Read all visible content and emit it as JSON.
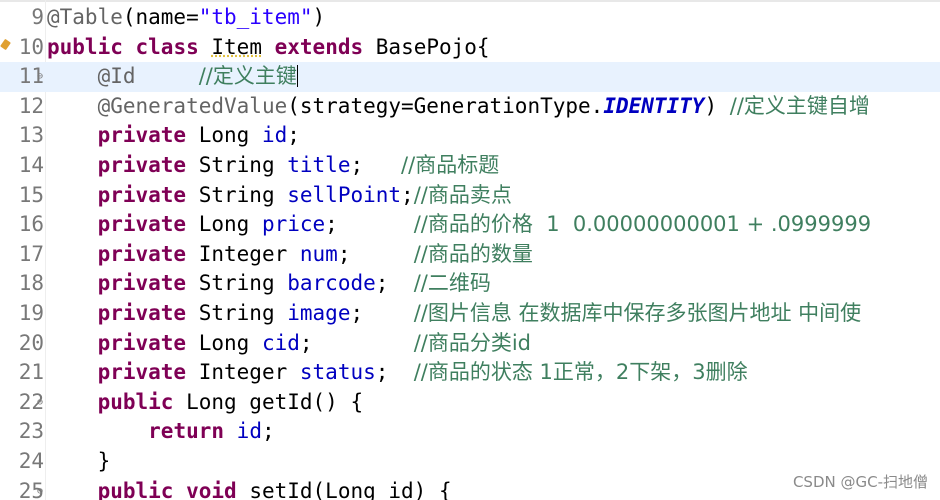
{
  "editor": {
    "lines": [
      {
        "num": "9",
        "tokens": [
          {
            "t": "ann",
            "v": "@Table"
          },
          {
            "t": "plain",
            "v": "(name="
          },
          {
            "t": "str",
            "v": "\"tb_item\""
          },
          {
            "t": "plain",
            "v": ")"
          }
        ]
      },
      {
        "num": "10",
        "marker": true,
        "tokens": [
          {
            "t": "kw",
            "v": "public"
          },
          {
            "t": "plain",
            "v": " "
          },
          {
            "t": "kw",
            "v": "class"
          },
          {
            "t": "plain",
            "v": " "
          },
          {
            "t": "plain",
            "v": "Item",
            "ul": true
          },
          {
            "t": "plain",
            "v": " "
          },
          {
            "t": "kw",
            "v": "extends"
          },
          {
            "t": "plain",
            "v": " BasePojo{"
          }
        ]
      },
      {
        "num": "11",
        "fold": true,
        "current": true,
        "cursor": true,
        "tokens": [
          {
            "t": "plain",
            "v": "    "
          },
          {
            "t": "ann",
            "v": "@Id"
          },
          {
            "t": "plain",
            "v": "     "
          },
          {
            "t": "cmt",
            "v": "//定义主键"
          }
        ]
      },
      {
        "num": "12",
        "tokens": [
          {
            "t": "plain",
            "v": "    "
          },
          {
            "t": "ann",
            "v": "@GeneratedValue"
          },
          {
            "t": "plain",
            "v": "(strategy=GenerationType."
          },
          {
            "t": "cst",
            "v": "IDENTITY"
          },
          {
            "t": "plain",
            "v": ") "
          },
          {
            "t": "cmt",
            "v": "//定义主键自增"
          }
        ]
      },
      {
        "num": "13",
        "tokens": [
          {
            "t": "plain",
            "v": "    "
          },
          {
            "t": "kw",
            "v": "private"
          },
          {
            "t": "plain",
            "v": " Long "
          },
          {
            "t": "fld",
            "v": "id"
          },
          {
            "t": "plain",
            "v": ";"
          }
        ]
      },
      {
        "num": "14",
        "tokens": [
          {
            "t": "plain",
            "v": "    "
          },
          {
            "t": "kw",
            "v": "private"
          },
          {
            "t": "plain",
            "v": " String "
          },
          {
            "t": "fld",
            "v": "title"
          },
          {
            "t": "plain",
            "v": ";   "
          },
          {
            "t": "cmt",
            "v": "//商品标题"
          }
        ]
      },
      {
        "num": "15",
        "tokens": [
          {
            "t": "plain",
            "v": "    "
          },
          {
            "t": "kw",
            "v": "private"
          },
          {
            "t": "plain",
            "v": " String "
          },
          {
            "t": "fld",
            "v": "sellPoint"
          },
          {
            "t": "plain",
            "v": ";"
          },
          {
            "t": "cmt",
            "v": "//商品卖点"
          }
        ]
      },
      {
        "num": "16",
        "tokens": [
          {
            "t": "plain",
            "v": "    "
          },
          {
            "t": "kw",
            "v": "private"
          },
          {
            "t": "plain",
            "v": " Long "
          },
          {
            "t": "fld",
            "v": "price"
          },
          {
            "t": "plain",
            "v": ";      "
          },
          {
            "t": "cmt",
            "v": "//商品的价格  1  0.00000000001 + .0999999"
          }
        ]
      },
      {
        "num": "17",
        "tokens": [
          {
            "t": "plain",
            "v": "    "
          },
          {
            "t": "kw",
            "v": "private"
          },
          {
            "t": "plain",
            "v": " Integer "
          },
          {
            "t": "fld",
            "v": "num"
          },
          {
            "t": "plain",
            "v": ";     "
          },
          {
            "t": "cmt",
            "v": "//商品的数量"
          }
        ]
      },
      {
        "num": "18",
        "tokens": [
          {
            "t": "plain",
            "v": "    "
          },
          {
            "t": "kw",
            "v": "private"
          },
          {
            "t": "plain",
            "v": " String "
          },
          {
            "t": "fld",
            "v": "barcode"
          },
          {
            "t": "plain",
            "v": ";  "
          },
          {
            "t": "cmt",
            "v": "//二维码"
          }
        ]
      },
      {
        "num": "19",
        "tokens": [
          {
            "t": "plain",
            "v": "    "
          },
          {
            "t": "kw",
            "v": "private"
          },
          {
            "t": "plain",
            "v": " String "
          },
          {
            "t": "fld",
            "v": "image"
          },
          {
            "t": "plain",
            "v": ";    "
          },
          {
            "t": "cmt",
            "v": "//图片信息 在数据库中保存多张图片地址 中间使"
          }
        ]
      },
      {
        "num": "20",
        "tokens": [
          {
            "t": "plain",
            "v": "    "
          },
          {
            "t": "kw",
            "v": "private"
          },
          {
            "t": "plain",
            "v": " Long "
          },
          {
            "t": "fld",
            "v": "cid"
          },
          {
            "t": "plain",
            "v": ";        "
          },
          {
            "t": "cmt",
            "v": "//商品分类id"
          }
        ]
      },
      {
        "num": "21",
        "tokens": [
          {
            "t": "plain",
            "v": "    "
          },
          {
            "t": "kw",
            "v": "private"
          },
          {
            "t": "plain",
            "v": " Integer "
          },
          {
            "t": "fld",
            "v": "status"
          },
          {
            "t": "plain",
            "v": ";  "
          },
          {
            "t": "cmt",
            "v": "//商品的状态 1正常，2下架，3删除"
          }
        ]
      },
      {
        "num": "22",
        "fold": true,
        "tokens": [
          {
            "t": "plain",
            "v": "    "
          },
          {
            "t": "kw",
            "v": "public"
          },
          {
            "t": "plain",
            "v": " Long getId() {"
          }
        ]
      },
      {
        "num": "23",
        "tokens": [
          {
            "t": "plain",
            "v": "        "
          },
          {
            "t": "kw",
            "v": "return"
          },
          {
            "t": "plain",
            "v": " "
          },
          {
            "t": "fld",
            "v": "id"
          },
          {
            "t": "plain",
            "v": ";"
          }
        ]
      },
      {
        "num": "24",
        "tokens": [
          {
            "t": "plain",
            "v": "    }"
          }
        ]
      },
      {
        "num": "25",
        "fold": true,
        "tokens": [
          {
            "t": "plain",
            "v": "    "
          },
          {
            "t": "kw",
            "v": "public"
          },
          {
            "t": "plain",
            "v": " "
          },
          {
            "t": "kw",
            "v": "void"
          },
          {
            "t": "plain",
            "v": " setId(Long id) {"
          }
        ]
      }
    ],
    "fold_glyph": "⊖"
  },
  "watermark": "CSDN @GC-扫地僧"
}
